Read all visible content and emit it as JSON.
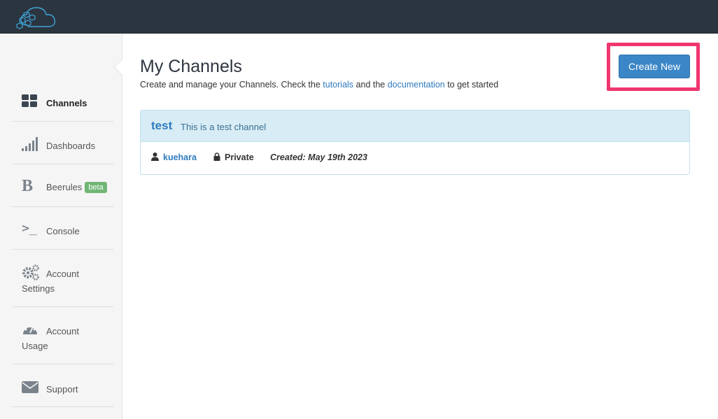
{
  "sidebar": {
    "items": [
      {
        "label": "Channels",
        "icon": "grid-icon"
      },
      {
        "label": "Dashboards",
        "icon": "signal-bars-icon"
      },
      {
        "label": "Beerules",
        "icon": "bold-b-icon",
        "badge": "beta"
      },
      {
        "label": "Console",
        "icon": "terminal-prompt-icon",
        "glyph": ">_"
      },
      {
        "label": "Account",
        "label2": "Settings",
        "icon": "gears-icon"
      },
      {
        "label": "Account",
        "label2": "Usage",
        "icon": "dashboard-gauge-icon"
      },
      {
        "label": "Support",
        "icon": "envelope-icon"
      }
    ]
  },
  "main": {
    "title": "My Channels",
    "subtitle_pre": "Create and manage your Channels. Check the ",
    "subtitle_link1": "tutorials",
    "subtitle_mid": " and the ",
    "subtitle_link2": "documentation",
    "subtitle_post": " to get started",
    "create_button": "Create New"
  },
  "channels": [
    {
      "name": "test",
      "description": "This is a test channel",
      "owner": "kuehara",
      "visibility": "Private",
      "created": "Created: May 19th 2023"
    }
  ],
  "colors": {
    "topbar": "#2b3540",
    "accent": "#3b86c6",
    "highlight": "#f0366f",
    "badge": "#6fb675"
  }
}
